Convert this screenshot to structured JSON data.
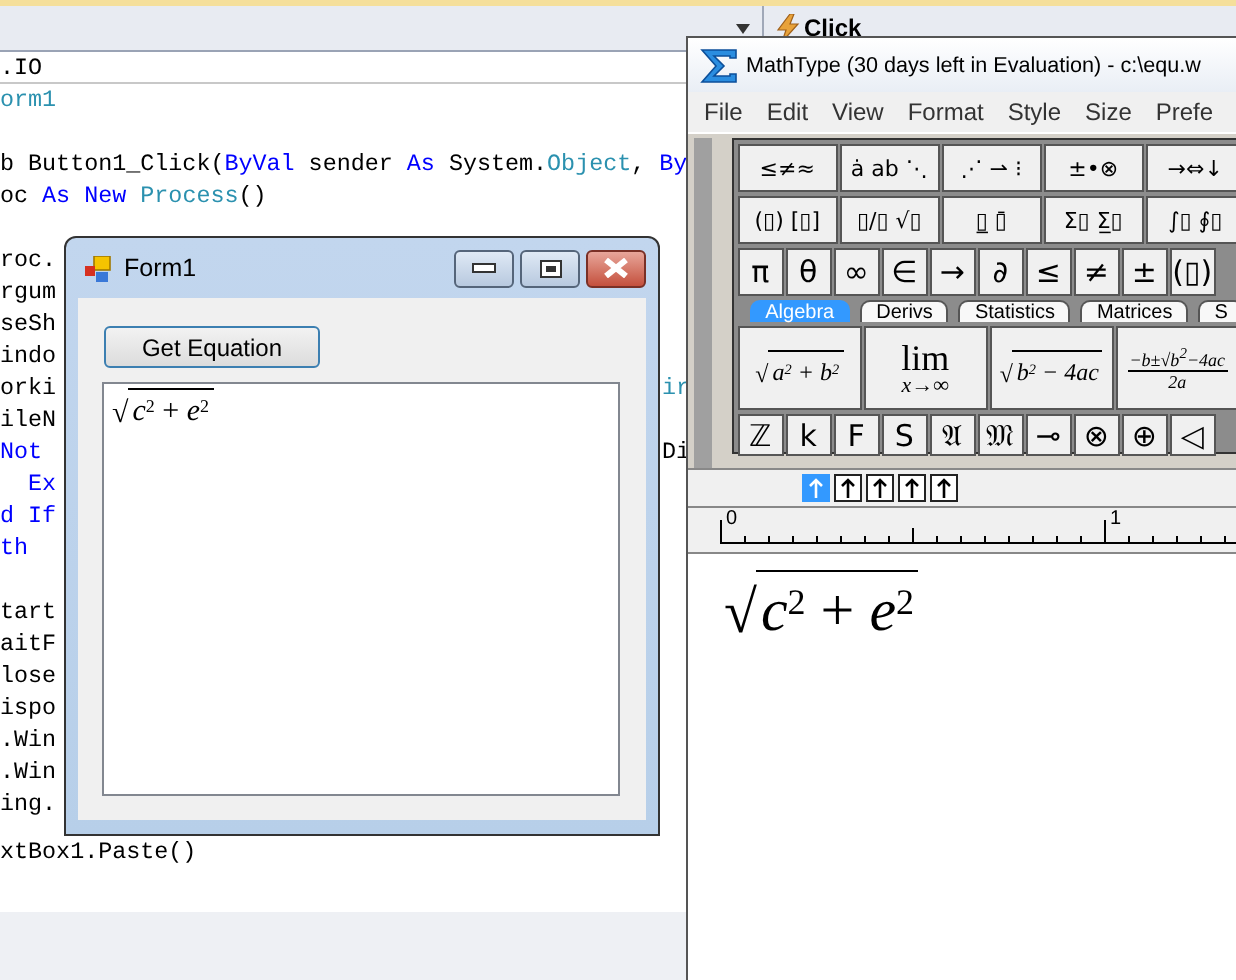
{
  "ide": {
    "member_dropdown": {
      "label": "Click"
    },
    "code_lines": [
      {
        "kind": "code",
        "separator": true,
        "segments": [
          {
            "text": ".IO",
            "kind": "plain"
          }
        ]
      },
      {
        "kind": "code",
        "segments": [
          {
            "text": "orm1",
            "kind": "type"
          }
        ]
      },
      {
        "kind": "blank"
      },
      {
        "kind": "code",
        "segments": [
          {
            "text": "b Button1_Click(",
            "kind": "plain"
          },
          {
            "text": "ByVal",
            "kind": "keyword"
          },
          {
            "text": " sender ",
            "kind": "plain"
          },
          {
            "text": "As",
            "kind": "keyword"
          },
          {
            "text": " System.",
            "kind": "plain"
          },
          {
            "text": "Object",
            "kind": "type"
          },
          {
            "text": ", ",
            "kind": "plain"
          },
          {
            "text": "By",
            "kind": "keyword"
          }
        ]
      },
      {
        "kind": "code",
        "segments": [
          {
            "text": "oc ",
            "kind": "plain"
          },
          {
            "text": "As",
            "kind": "keyword"
          },
          {
            "text": " New",
            "kind": "keyword"
          },
          {
            "text": " Process",
            "kind": "type"
          },
          {
            "text": "()",
            "kind": "plain"
          }
        ]
      },
      {
        "kind": "blank"
      },
      {
        "kind": "code",
        "segments": [
          {
            "text": "roc.",
            "kind": "plain"
          }
        ]
      },
      {
        "kind": "code",
        "segments": [
          {
            "text": "rgum",
            "kind": "plain"
          }
        ]
      },
      {
        "kind": "code",
        "segments": [
          {
            "text": "seSh",
            "kind": "plain"
          }
        ]
      },
      {
        "kind": "code",
        "segments": [
          {
            "text": "indo",
            "kind": "plain"
          }
        ]
      },
      {
        "kind": "code",
        "segments": [
          {
            "text": "orki",
            "kind": "plain"
          }
        ],
        "tail": {
          "text": "ir",
          "kind": "type"
        }
      },
      {
        "kind": "code",
        "segments": [
          {
            "text": "ileN",
            "kind": "plain"
          }
        ]
      },
      {
        "kind": "code",
        "segments": [
          {
            "text": "Not",
            "kind": "keyword"
          }
        ],
        "tail": {
          "text": "Di",
          "kind": "plain"
        }
      },
      {
        "kind": "code",
        "segments": [
          {
            "text": "  Ex",
            "kind": "keyword"
          }
        ]
      },
      {
        "kind": "code",
        "segments": [
          {
            "text": "d If",
            "kind": "keyword"
          }
        ]
      },
      {
        "kind": "code",
        "segments": [
          {
            "text": "th",
            "kind": "keyword"
          }
        ]
      },
      {
        "kind": "blank"
      },
      {
        "kind": "code",
        "segments": [
          {
            "text": "tart",
            "kind": "plain"
          }
        ]
      },
      {
        "kind": "code",
        "segments": [
          {
            "text": "aitF",
            "kind": "plain"
          }
        ]
      },
      {
        "kind": "code",
        "segments": [
          {
            "text": "lose",
            "kind": "plain"
          }
        ]
      },
      {
        "kind": "code",
        "segments": [
          {
            "text": "ispo",
            "kind": "plain"
          }
        ]
      },
      {
        "kind": "code",
        "segments": [
          {
            "text": ".Win",
            "kind": "plain"
          }
        ]
      },
      {
        "kind": "code",
        "segments": [
          {
            "text": ".Win",
            "kind": "plain"
          }
        ]
      },
      {
        "kind": "code",
        "segments": [
          {
            "text": "ing.",
            "kind": "plain"
          }
        ]
      },
      {
        "kind": "code",
        "segments": [
          {
            "text": "xtBox1.Paste()",
            "kind": "plain"
          }
        ]
      }
    ]
  },
  "form_window": {
    "title": "Form1",
    "button": "Get Equation",
    "equation": {
      "radical": "√",
      "radicand": "*c*$^{2}$ + *e*$^{2}$"
    }
  },
  "mathtype": {
    "title": "MathType (30 days left in Evaluation) - c:\\equ.w",
    "menu": [
      "File",
      "Edit",
      "View",
      "Format",
      "Style",
      "Size",
      "Prefe"
    ],
    "palette_rows": [
      [
        "≤≠≈",
        "ȧ ab ⋱",
        "⋰ ⇀ ⁝",
        "±•⊗",
        "→⇔↓"
      ],
      [
        "(▯) [▯]",
        "▯/▯ √▯",
        "▯̲ ▯̄",
        "Σ▯ Σ̲▯",
        "∫▯ ∮▯"
      ]
    ],
    "symbol_row": [
      "π",
      "θ",
      "∞",
      "∈",
      "→",
      "∂",
      "≤",
      "≠",
      "±",
      "(▯)"
    ],
    "tabs": [
      {
        "label": "Algebra",
        "selected": true
      },
      {
        "label": "Derivs",
        "selected": false
      },
      {
        "label": "Statistics",
        "selected": false
      },
      {
        "label": "Matrices",
        "selected": false
      },
      {
        "label": "S",
        "selected": false
      }
    ],
    "templates": [
      {
        "kind": "radical",
        "radical": "√",
        "radicand": "a$^{2}$ + b$^{2}$"
      },
      {
        "kind": "limit",
        "operator": "lim",
        "under": "x→∞"
      },
      {
        "kind": "radical",
        "radical": "√",
        "radicand": "b$^{2}$ − 4ac"
      },
      {
        "kind": "fraction",
        "numerator": "−b±√b$^{2}$−4ac",
        "denominator": "2a"
      }
    ],
    "letter_row": [
      "ℤ",
      "k",
      "F",
      "S",
      "𝔄",
      "𝔐",
      "⊸",
      "⊗",
      "⊕",
      "◁"
    ],
    "nudge_tools": [
      {
        "selected": true
      },
      {
        "selected": false
      },
      {
        "selected": false
      },
      {
        "selected": false
      },
      {
        "selected": false
      }
    ],
    "ruler": {
      "labels": [
        "0",
        "1"
      ]
    },
    "equation": {
      "radical": "√",
      "radicand": "*c*$^{2}$ + *e*$^{2}$"
    }
  }
}
